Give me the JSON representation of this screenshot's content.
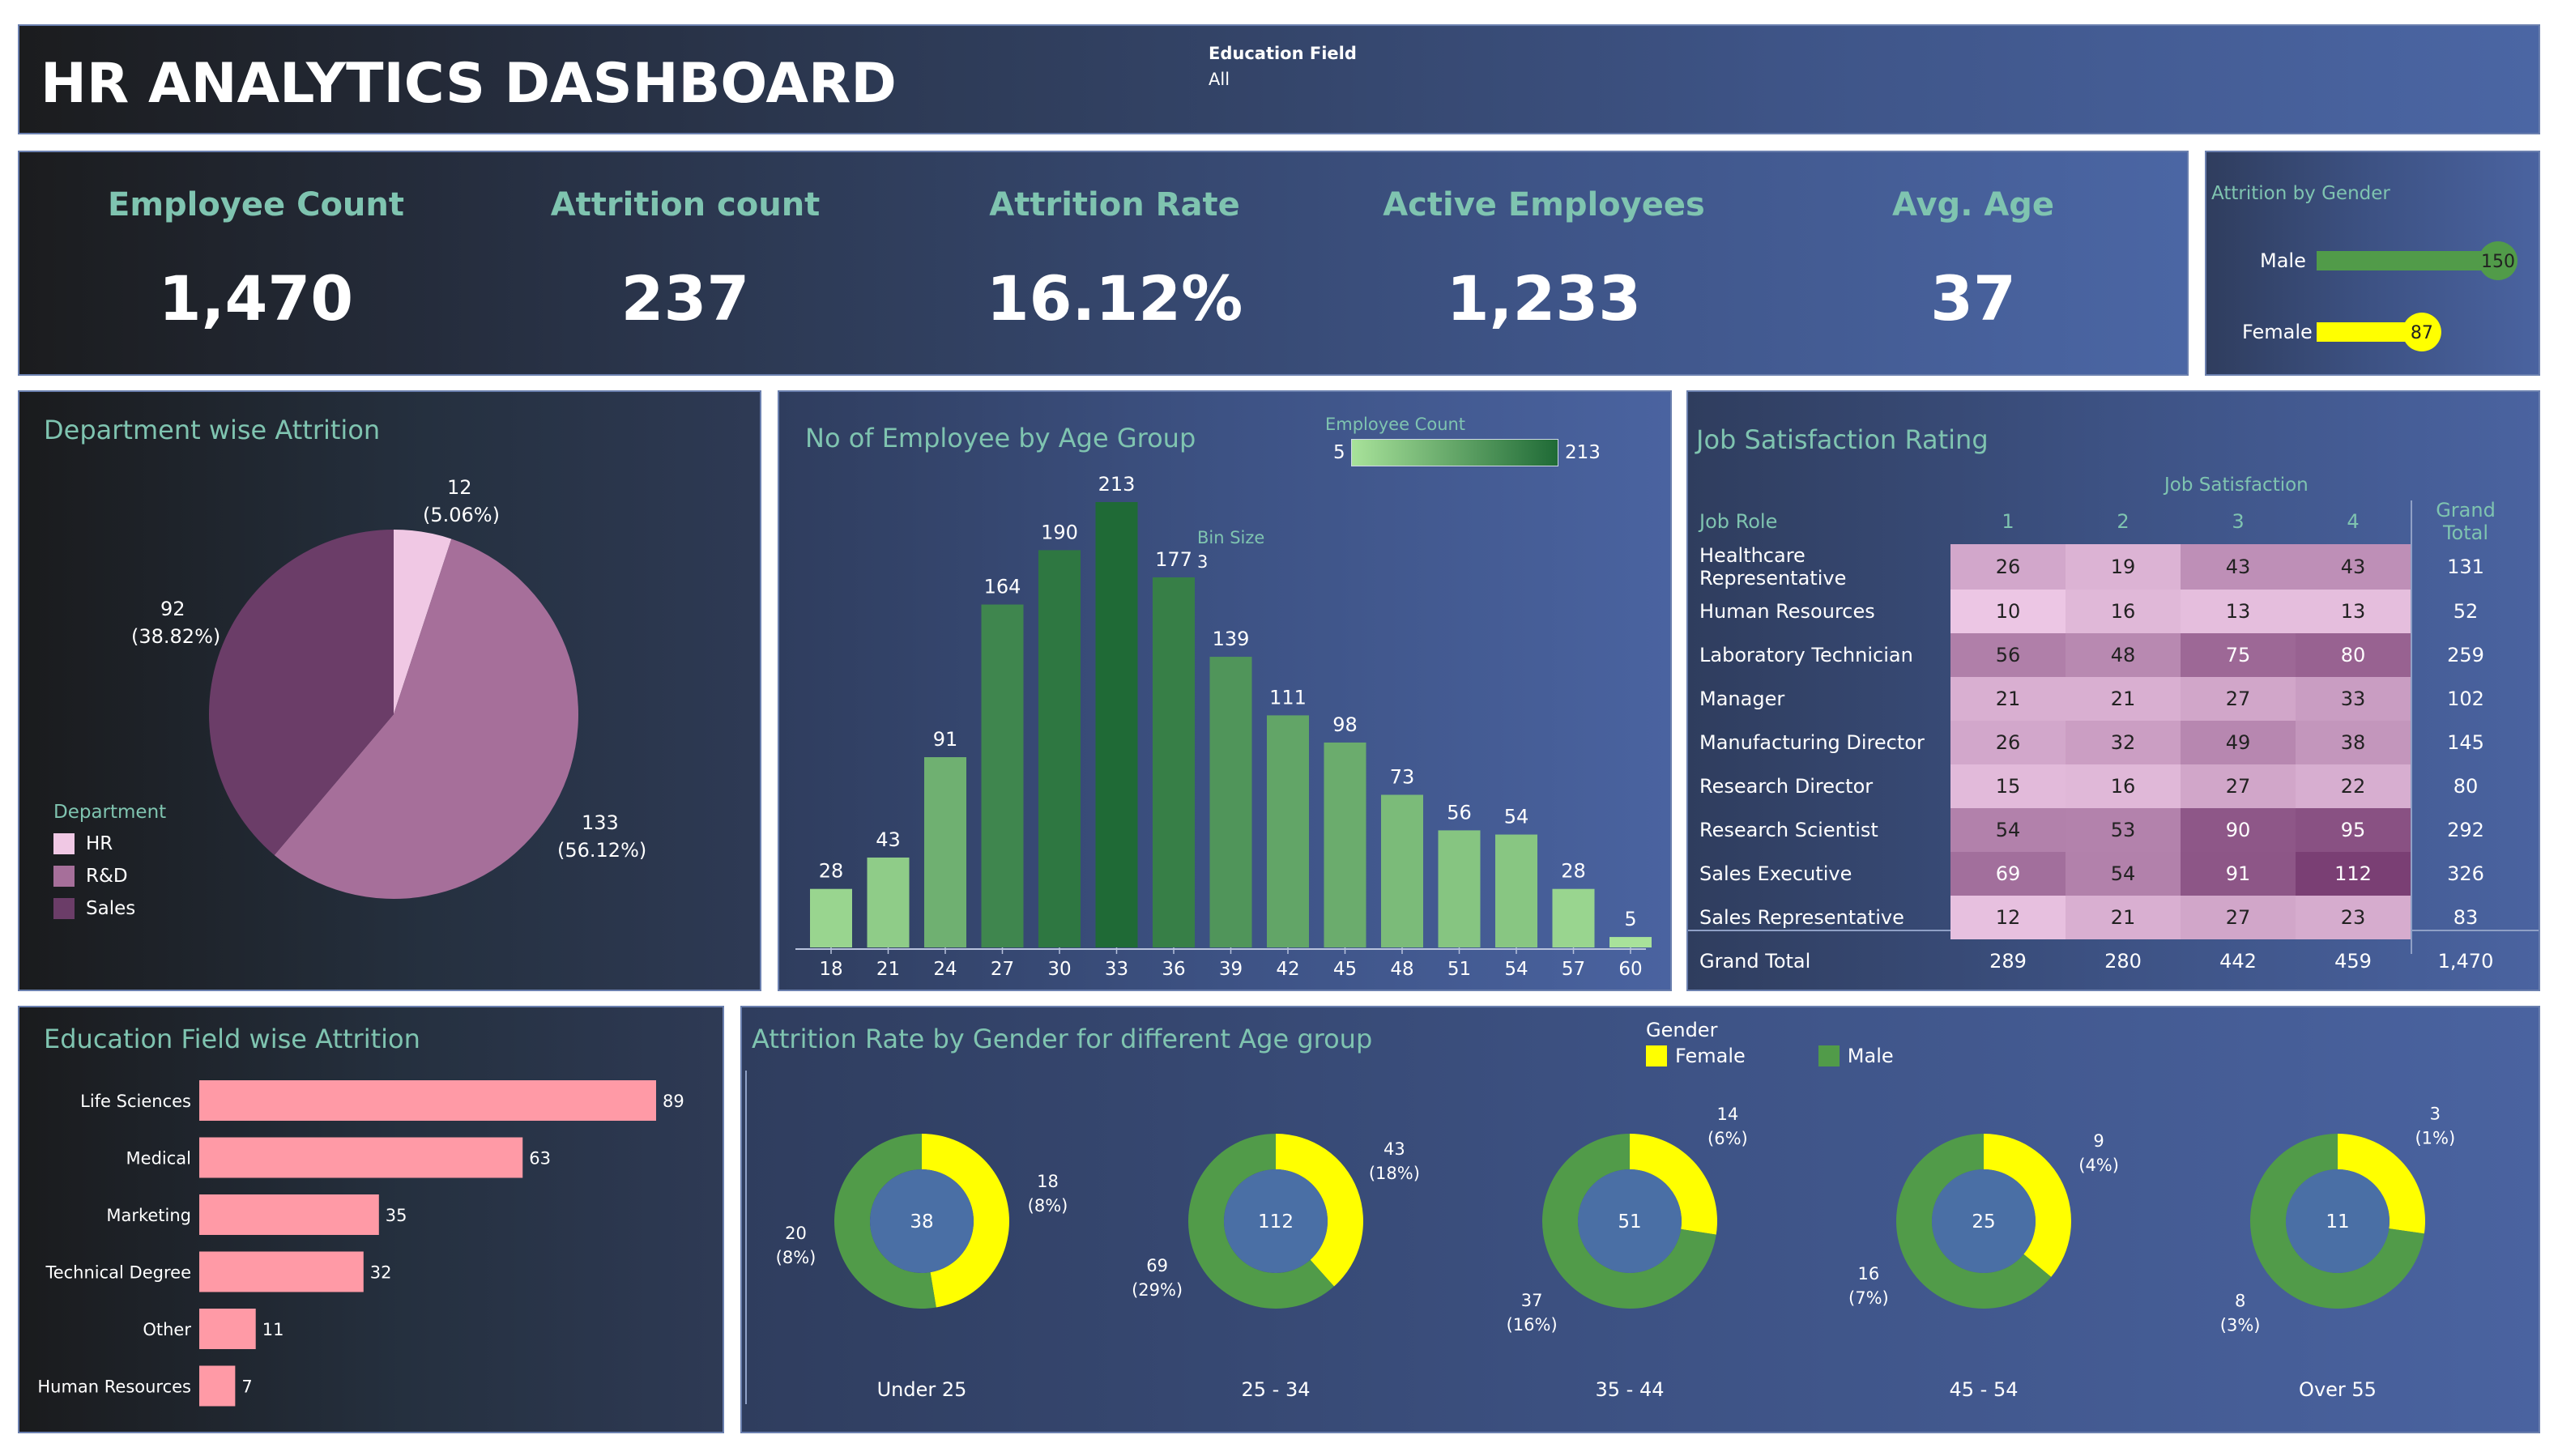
{
  "header": {
    "title": "HR ANALYTICS DASHBOARD",
    "filter_label": "Education Field",
    "filter_value": "All"
  },
  "kpis": [
    {
      "label": "Employee Count",
      "value": "1,470"
    },
    {
      "label": "Attrition count",
      "value": "237"
    },
    {
      "label": "Attrition Rate",
      "value": "16.12%"
    },
    {
      "label": "Active Employees",
      "value": "1,233"
    },
    {
      "label": "Avg. Age",
      "value": "37"
    }
  ],
  "gender_attrition": {
    "title": "Attrition by Gender",
    "rows": [
      {
        "label": "Male",
        "value": 150
      },
      {
        "label": "Female",
        "value": 87
      }
    ]
  },
  "department": {
    "title": "Department wise Attrition",
    "legend_title": "Department",
    "labels": [
      "12",
      "(5.06%)",
      "133",
      "(56.12%)",
      "92",
      "(38.82%)"
    ]
  },
  "age_group": {
    "title": "No of Employee by Age Group",
    "legend_title": "Employee Count",
    "legend_min": "5",
    "legend_max": "213",
    "bin_label": "Bin Size",
    "bin_value": "3"
  },
  "job_satisfaction": {
    "title": "Job Satisfaction Rating",
    "col_group": "Job Satisfaction",
    "row_header": "Job Role",
    "grand_total_label": "Grand Total",
    "columns": [
      "1",
      "2",
      "3",
      "4"
    ],
    "rows": [
      {
        "role": "Healthcare Representative",
        "values": [
          "26",
          "19",
          "43",
          "43"
        ],
        "total": "131"
      },
      {
        "role": "Human Resources",
        "values": [
          "10",
          "16",
          "13",
          "13"
        ],
        "total": "52"
      },
      {
        "role": "Laboratory Technician",
        "values": [
          "56",
          "48",
          "75",
          "80"
        ],
        "total": "259"
      },
      {
        "role": "Manager",
        "values": [
          "21",
          "21",
          "27",
          "33"
        ],
        "total": "102"
      },
      {
        "role": "Manufacturing Director",
        "values": [
          "26",
          "32",
          "49",
          "38"
        ],
        "total": "145"
      },
      {
        "role": "Research Director",
        "values": [
          "15",
          "16",
          "27",
          "22"
        ],
        "total": "80"
      },
      {
        "role": "Research Scientist",
        "values": [
          "54",
          "53",
          "90",
          "95"
        ],
        "total": "292"
      },
      {
        "role": "Sales Executive",
        "values": [
          "69",
          "54",
          "91",
          "112"
        ],
        "total": "326"
      },
      {
        "role": "Sales Representative",
        "values": [
          "12",
          "21",
          "27",
          "23"
        ],
        "total": "83"
      }
    ],
    "totals": [
      "289",
      "280",
      "442",
      "459"
    ],
    "grand_total": "1,470"
  },
  "education": {
    "title": "Education Field wise Attrition"
  },
  "age_gender": {
    "title": "Attrition Rate by Gender for different Age group",
    "legend_title": "Gender",
    "groups": [
      {
        "label": "Under 25",
        "total": "38",
        "female": "18",
        "female_pct": "(8%)",
        "male": "20",
        "male_pct": "(8%)"
      },
      {
        "label": "25 - 34",
        "total": "112",
        "female": "43",
        "female_pct": "(18%)",
        "male": "69",
        "male_pct": "(29%)"
      },
      {
        "label": "35 - 44",
        "total": "51",
        "female": "14",
        "female_pct": "(6%)",
        "male": "37",
        "male_pct": "(16%)"
      },
      {
        "label": "45 - 54",
        "total": "25",
        "female": "9",
        "female_pct": "(4%)",
        "male": "16",
        "male_pct": "(7%)"
      },
      {
        "label": "Over 55",
        "total": "11",
        "female": "3",
        "female_pct": "(1%)",
        "male": "8",
        "male_pct": "(3%)"
      }
    ]
  },
  "colors": {
    "title_teal": "#7fc4b0",
    "female": "#ffff00",
    "male": "#519b49",
    "hr": "#f0c8e4",
    "rnd": "#a66f9a",
    "sales": "#6b3d68",
    "edu_bar": "#ff9aa6"
  },
  "chart_data": [
    {
      "type": "pie",
      "title": "Department wise Attrition",
      "categories": [
        "HR",
        "R&D",
        "Sales"
      ],
      "values": [
        12,
        133,
        92
      ],
      "percentages": [
        5.06,
        56.12,
        38.82
      ]
    },
    {
      "type": "bar",
      "title": "No of Employee by Age Group",
      "categories": [
        "18",
        "21",
        "24",
        "27",
        "30",
        "33",
        "36",
        "39",
        "42",
        "45",
        "48",
        "51",
        "54",
        "57",
        "60"
      ],
      "values": [
        28,
        43,
        91,
        164,
        190,
        213,
        177,
        139,
        111,
        98,
        73,
        56,
        54,
        28,
        5
      ]
    },
    {
      "type": "bar",
      "title": "Education Field wise Attrition",
      "categories": [
        "Life Sciences",
        "Medical",
        "Marketing",
        "Technical Degree",
        "Other",
        "Human Resources"
      ],
      "values": [
        89,
        63,
        35,
        32,
        11,
        7
      ]
    },
    {
      "type": "bar",
      "title": "Attrition by Gender",
      "categories": [
        "Male",
        "Female"
      ],
      "values": [
        150,
        87
      ]
    },
    {
      "type": "pie",
      "title": "Attrition Rate by Gender for different Age group",
      "categories": [
        "Under 25",
        "25 - 34",
        "35 - 44",
        "45 - 54",
        "Over 55"
      ],
      "series": [
        {
          "name": "Female",
          "values": [
            18,
            43,
            14,
            9,
            3
          ]
        },
        {
          "name": "Male",
          "values": [
            20,
            69,
            37,
            16,
            8
          ]
        }
      ]
    },
    {
      "type": "heatmap",
      "title": "Job Satisfaction Rating",
      "x": [
        "1",
        "2",
        "3",
        "4"
      ],
      "y": [
        "Healthcare Representative",
        "Human Resources",
        "Laboratory Technician",
        "Manager",
        "Manufacturing Director",
        "Research Director",
        "Research Scientist",
        "Sales Executive",
        "Sales Representative"
      ],
      "values": [
        [
          26,
          19,
          43,
          43
        ],
        [
          10,
          16,
          13,
          13
        ],
        [
          56,
          48,
          75,
          80
        ],
        [
          21,
          21,
          27,
          33
        ],
        [
          26,
          32,
          49,
          38
        ],
        [
          15,
          16,
          27,
          22
        ],
        [
          54,
          53,
          90,
          95
        ],
        [
          69,
          54,
          91,
          112
        ],
        [
          12,
          21,
          27,
          23
        ]
      ]
    }
  ]
}
